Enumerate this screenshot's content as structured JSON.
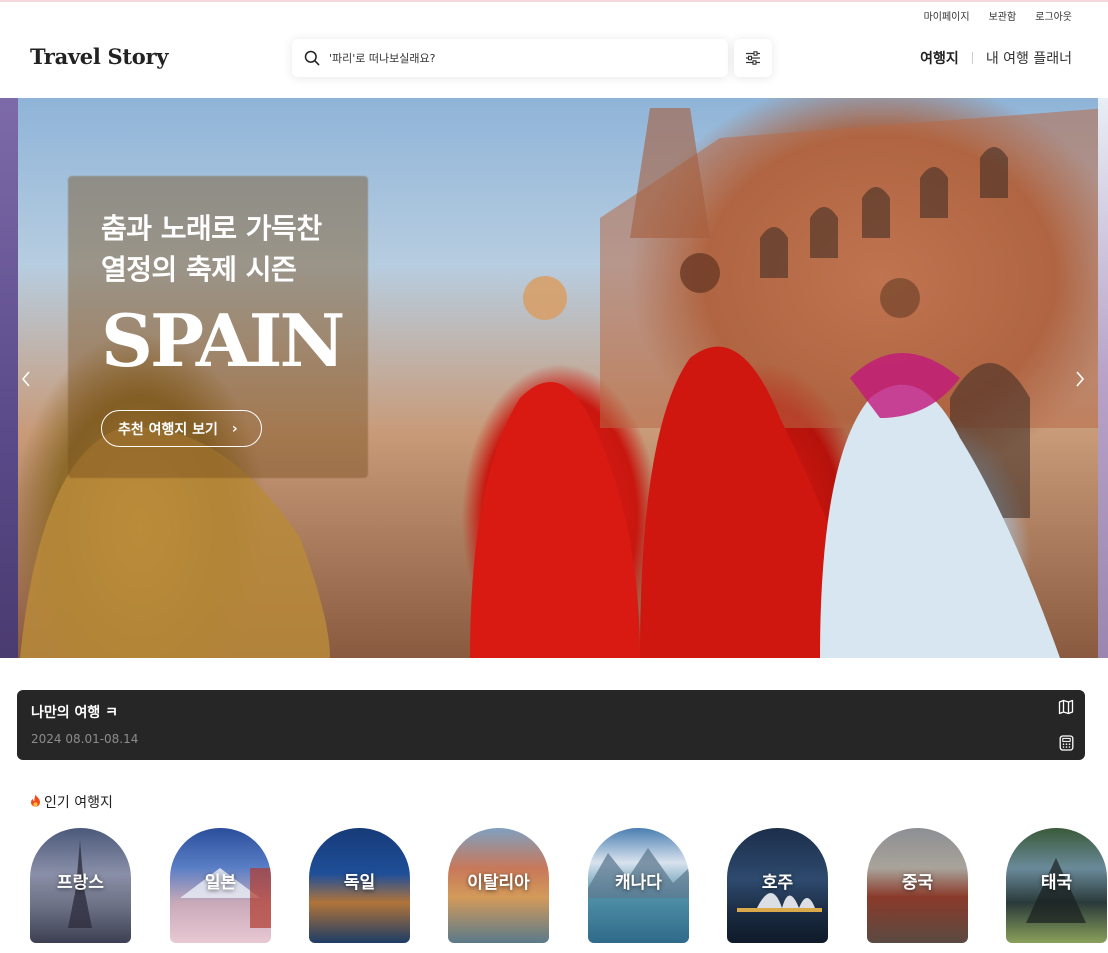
{
  "util_links": [
    "마이페이지",
    "보관함",
    "로그아웃"
  ],
  "header": {
    "logo": "Travel Story",
    "search_placeholder": "'파리'로 떠나보실래요?",
    "nav": [
      "여행지",
      "내 여행 플래너"
    ]
  },
  "hero": {
    "title_line1": "춤과 노래로 가득찬",
    "title_line2": "열정의 축제 시즌",
    "country": "SPAIN",
    "cta": "추천 여행지 보기",
    "cta_icon": "chevron-right-icon",
    "prev_icon": "chevron-left-icon",
    "next_icon": "chevron-right-icon"
  },
  "trip": {
    "title": "나만의 여행 ㅋ",
    "date": "2024 08.01-08.14",
    "icons": [
      "map-icon",
      "calculator-icon"
    ]
  },
  "popular": {
    "heading": "인기 여행지",
    "heading_icon": "fire-icon",
    "destinations": [
      {
        "name": "프랑스"
      },
      {
        "name": "일본"
      },
      {
        "name": "독일"
      },
      {
        "name": "이탈리아"
      },
      {
        "name": "캐나다"
      },
      {
        "name": "호주"
      },
      {
        "name": "중국"
      },
      {
        "name": "태국"
      }
    ]
  },
  "colors": {
    "trip_card": "#262626",
    "fire": "#f04b1c"
  }
}
